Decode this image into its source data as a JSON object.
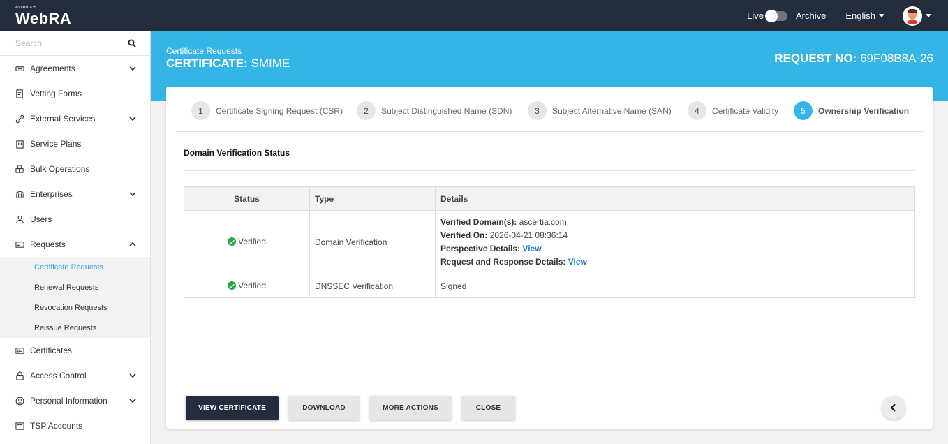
{
  "app": {
    "brand_small": "Ascertia™",
    "brand": "WebRA"
  },
  "topbar": {
    "live_label": "Live",
    "archive_label": "Archive",
    "language": "English",
    "avatar_icon": "user-avatar"
  },
  "search": {
    "placeholder": "Search"
  },
  "sidebar": {
    "items": [
      {
        "label": "Agreements",
        "icon": "handshake-icon",
        "expandable": true
      },
      {
        "label": "Vetting Forms",
        "icon": "form-icon",
        "expandable": false
      },
      {
        "label": "External Services",
        "icon": "link-icon",
        "expandable": true
      },
      {
        "label": "Service Plans",
        "icon": "plan-icon",
        "expandable": false
      },
      {
        "label": "Bulk Operations",
        "icon": "bulk-icon",
        "expandable": false
      },
      {
        "label": "Enterprises",
        "icon": "bank-icon",
        "expandable": true
      },
      {
        "label": "Users",
        "icon": "user-icon",
        "expandable": false
      },
      {
        "label": "Requests",
        "icon": "requests-icon",
        "expandable": true,
        "expanded": true
      }
    ],
    "sub_items": [
      {
        "label": "Certificate Requests",
        "active": true
      },
      {
        "label": "Renewal Requests"
      },
      {
        "label": "Revocation Requests"
      },
      {
        "label": "Reissue Requests"
      }
    ],
    "items_after": [
      {
        "label": "Certificates",
        "icon": "certificate-icon",
        "expandable": false
      },
      {
        "label": "Access Control",
        "icon": "lock-icon",
        "expandable": true
      },
      {
        "label": "Personal Information",
        "icon": "person-circle-icon",
        "expandable": true
      },
      {
        "label": "TSP Accounts",
        "icon": "tsp-icon",
        "expandable": false
      }
    ]
  },
  "header": {
    "breadcrumb": "Certificate Requests",
    "title_prefix": "CERTIFICATE:",
    "title_value": "SMIME",
    "request_prefix": "REQUEST NO:",
    "request_value": "69F08B8A-26"
  },
  "steps": [
    {
      "num": "1",
      "label": "Certificate Signing Request (CSR)"
    },
    {
      "num": "2",
      "label": "Subject Distinguished Name (SDN)"
    },
    {
      "num": "3",
      "label": "Subject Alternative Name (SAN)"
    },
    {
      "num": "4",
      "label": "Certificate Validity"
    },
    {
      "num": "5",
      "label": "Ownership Verification",
      "active": true
    }
  ],
  "section": {
    "title": "Domain Verification Status"
  },
  "table": {
    "headers": {
      "status": "Status",
      "type": "Type",
      "details": "Details"
    },
    "rows": [
      {
        "status": "Verified",
        "type": "Domain Verification",
        "details": {
          "domains_label": "Verified Domain(s):",
          "domains_value": "ascertia.com",
          "verified_on_label": "Verified On:",
          "verified_on_value": "2026-04-21 08:36:14",
          "perspective_label": "Perspective Details:",
          "perspective_link": "View",
          "reqresp_label": "Request and Response Details:",
          "reqresp_link": "View"
        }
      },
      {
        "status": "Verified",
        "type": "DNSSEC Verification",
        "details_text": "Signed"
      }
    ]
  },
  "buttons": {
    "view_certificate": "VIEW CERTIFICATE",
    "download": "DOWNLOAD",
    "more_actions": "MORE ACTIONS",
    "close": "CLOSE"
  },
  "colors": {
    "topbar": "#242d3c",
    "accent": "#35b5e5",
    "active_sub": "#2aa3d6",
    "verified": "#28a745",
    "link": "#1a7fd6"
  }
}
